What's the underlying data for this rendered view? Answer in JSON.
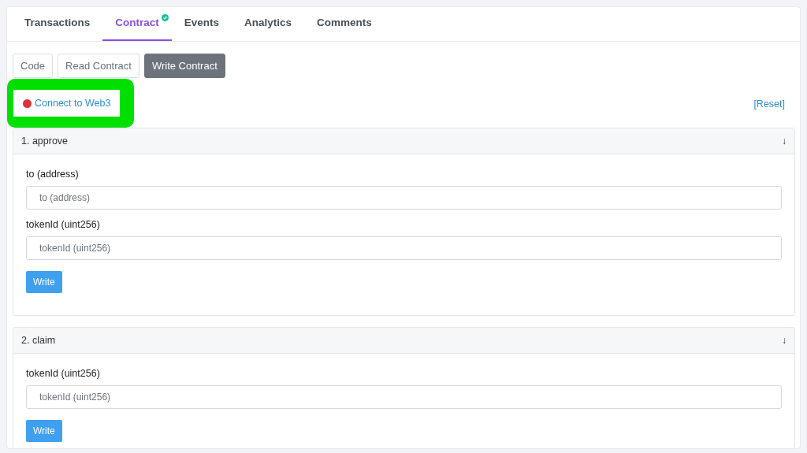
{
  "tabs": [
    {
      "label": "Transactions",
      "selected": false,
      "verified": false
    },
    {
      "label": "Contract",
      "selected": true,
      "verified": true
    },
    {
      "label": "Events",
      "selected": false,
      "verified": false
    },
    {
      "label": "Analytics",
      "selected": false,
      "verified": false
    },
    {
      "label": "Comments",
      "selected": false,
      "verified": false
    }
  ],
  "sub_tabs": [
    {
      "label": "Code",
      "selected": false
    },
    {
      "label": "Read Contract",
      "selected": false
    },
    {
      "label": "Write Contract",
      "selected": true
    }
  ],
  "connect": {
    "label": "Connect to Web3",
    "color": "#e0303a",
    "highlighted": true
  },
  "reset": "[Reset]",
  "functions": [
    {
      "title": "1. approve",
      "toggle": "↓",
      "inputs": [
        {
          "label": "to (address)",
          "placeholder": "to (address)"
        },
        {
          "label": "tokenId (uint256)",
          "placeholder": "tokenId (uint256)"
        }
      ],
      "button": "Write"
    },
    {
      "title": "2. claim",
      "toggle": "↓",
      "inputs": [
        {
          "label": "tokenId (uint256)",
          "placeholder": "tokenId (uint256)"
        }
      ],
      "button": "Write"
    }
  ]
}
